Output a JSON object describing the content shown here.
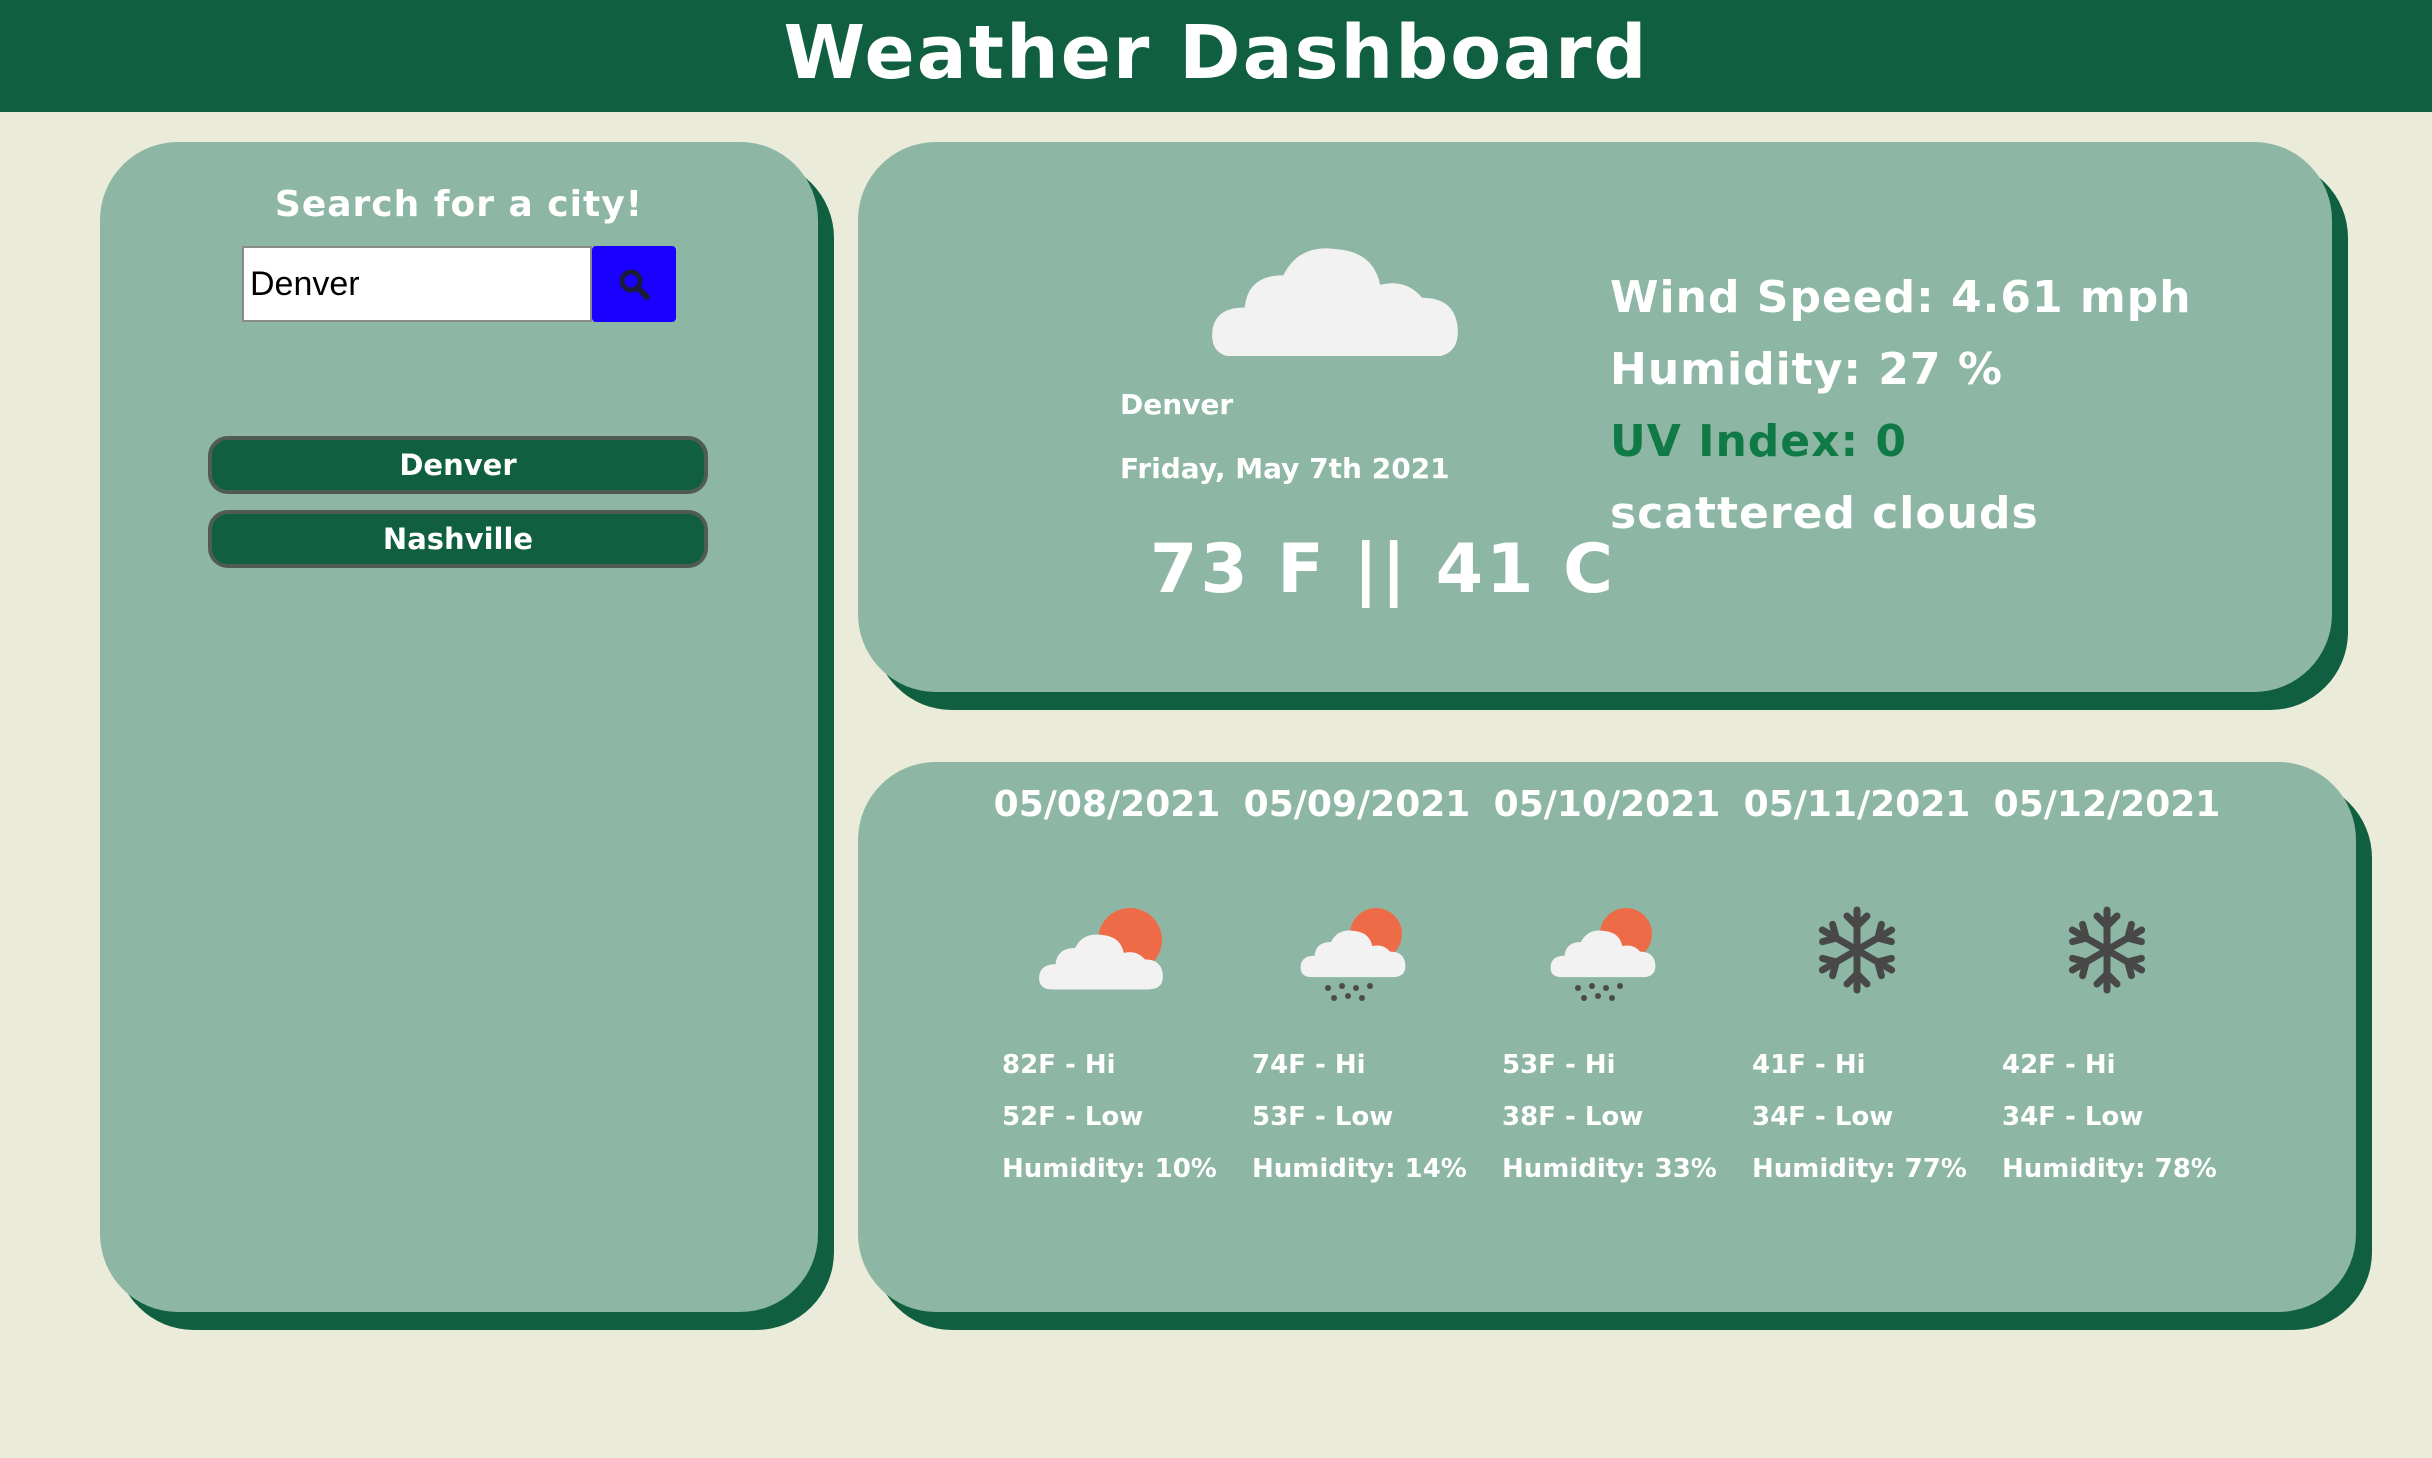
{
  "header": {
    "title": "Weather Dashboard"
  },
  "search": {
    "title": "Search for a city!",
    "value": "Denver",
    "history": [
      "Denver",
      "Nashville"
    ]
  },
  "current": {
    "city": "Denver",
    "date": "Friday, May 7th 2021",
    "temp": "73 F || 41 C",
    "wind": "Wind Speed: 4.61 mph",
    "humidity": "Humidity: 27 %",
    "uv": "UV Index: 0",
    "description": "scattered clouds",
    "icon": "cloud-icon",
    "uv_color": "#0f7a45"
  },
  "forecast": [
    {
      "date": "05/08/2021",
      "icon": "partly-cloudy-icon",
      "hi": "82F - Hi",
      "low": "52F - Low",
      "humidity": "Humidity: 10%"
    },
    {
      "date": "05/09/2021",
      "icon": "rain-sun-icon",
      "hi": "74F - Hi",
      "low": "53F - Low",
      "humidity": "Humidity: 14%"
    },
    {
      "date": "05/10/2021",
      "icon": "rain-sun-icon",
      "hi": "53F - Hi",
      "low": "38F - Low",
      "humidity": "Humidity: 33%"
    },
    {
      "date": "05/11/2021",
      "icon": "snowflake-icon",
      "hi": "41F - Hi",
      "low": "34F - Low",
      "humidity": "Humidity: 77%"
    },
    {
      "date": "05/12/2021",
      "icon": "snowflake-icon",
      "hi": "42F - Hi",
      "low": "34F - Low",
      "humidity": "Humidity: 78%"
    }
  ],
  "colors": {
    "background": "#ebebda",
    "header": "#0f5f40",
    "card": "#8db6a5",
    "search_button": "#1a00ff"
  }
}
